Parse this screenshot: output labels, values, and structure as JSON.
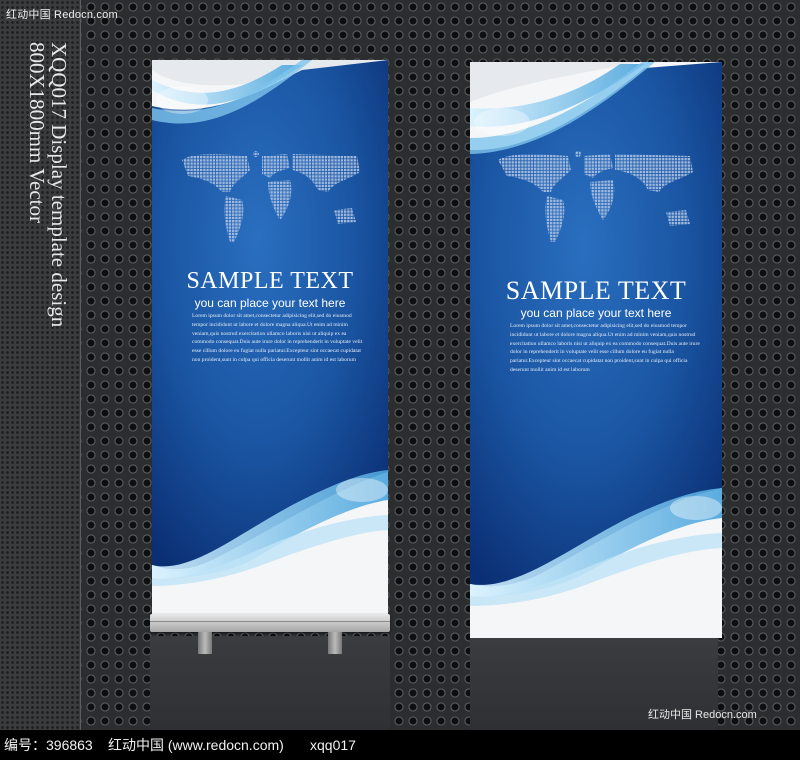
{
  "watermark_top": "红动中国 Redocn.com",
  "watermark_bottom_right": "红动中国 Redocn.com",
  "vertical_text": [
    "XQQ017 Display template design",
    "800X1800mm Vector"
  ],
  "banners": [
    {
      "title": "SAMPLE TEXT",
      "subtitle": "you can place your text here",
      "body": "Lorem ipsum dolor sit amet,consectetur adipisicing elit,sed do eiusmod tempor incididunt ut labore et dolore magna aliqua.Ut enim ad minim veniam,quis nostrud exercitation ullamco laboris nisi ut aliquip ex ea commodo consequat.Duis aute irure dolor in reprehenderit in voluptate velit esse cillum dolore eu fugiat nulla pariatur.Excepteur sint occaecat cupidatat non proident,sunt in culpa qui officia deserunt mollit anim id est laborum"
    },
    {
      "title": "SAMPLE TEXT",
      "subtitle": "you can place your text here",
      "body": "Lorem ipsum dolor sit amet,consectetur adipisicing elit,sed do eiusmod tempor incididunt ut labore et dolore magna aliqua.Ut enim ad minim veniam,quis nostrud exercitation ullamco laboris nisi ut aliquip ex ea commodo consequat.Duis aute irure dolor in reprehenderit in voluptate velit esse cillum dolore eu fugiat nulla pariatur.Excepteur sint occaecat cupidatat non proident,sunt in culpa qui officia deserunt mollit anim id est laborum"
    }
  ],
  "footer": {
    "id_label": "编号：",
    "id_value": "396863",
    "site": "红动中国 (www.redocn.com)",
    "code": "xqq017"
  },
  "colors": {
    "banner_blue": "#1c5aa6",
    "banner_dark": "#0b2f74",
    "wave_light": "#8fd0f0"
  }
}
